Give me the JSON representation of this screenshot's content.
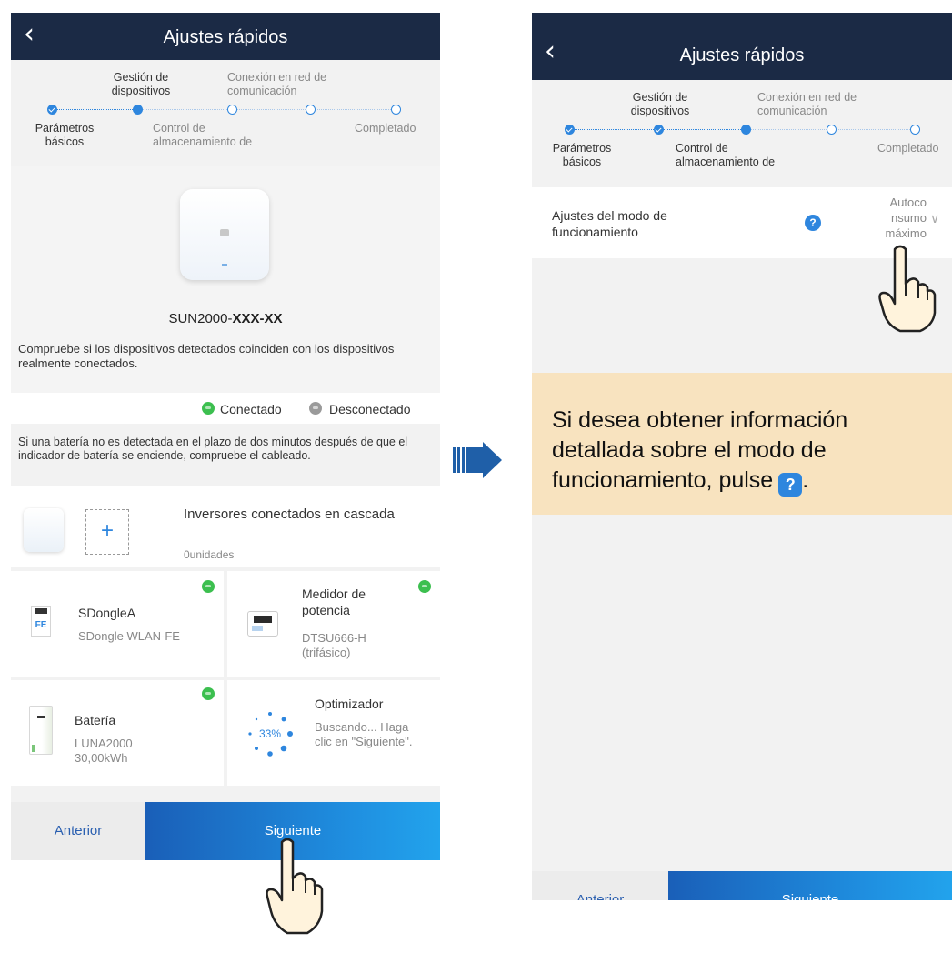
{
  "left": {
    "header": {
      "back_icon": "chevron-left-icon",
      "title": "Ajustes rápidos"
    },
    "steps": {
      "top_labels": [
        "Gestión de\ndispositivos",
        "Conexión en red de\ncomunicación"
      ],
      "bottom_labels": [
        "Parámetros\nbásicos",
        "Control de\nalmacenamiento de",
        "Completado"
      ]
    },
    "device": {
      "model_prefix": "SUN2000-",
      "model_bold": "XXX-XX"
    },
    "check_text": "Compruebe si los dispositivos detectados coinciden con los dispositivos realmente conectados.",
    "legend": {
      "connected": "Conectado",
      "disconnected": "Desconectado"
    },
    "battery_note": "Si una batería no es detectada en el plazo de dos minutos después de que el indicador de batería se enciende, compruebe el cableado.",
    "cascade": {
      "title": "Inversores conectados en cascada",
      "count": "0unidades",
      "add_icon": "plus-icon"
    },
    "cards": [
      {
        "name": "SDongleA",
        "detail": "SDongle WLAN-FE",
        "icon_text": "FE"
      },
      {
        "name": "Medidor de potencia",
        "detail": "DTSU666-H (trifásico)"
      },
      {
        "name": "Batería",
        "detail": "LUNA2000 30,00kWh"
      },
      {
        "name": "Optimizador",
        "detail": "Buscando... Haga clic en \"Siguiente\".",
        "progress": "33%"
      }
    ],
    "buttons": {
      "prev": "Anterior",
      "next": "Siguiente"
    }
  },
  "right": {
    "header": {
      "back_icon": "chevron-left-icon",
      "title": "Ajustes rápidos"
    },
    "steps": {
      "top_labels": [
        "Gestión de\ndispositivos",
        "Conexión en red de\ncomunicación"
      ],
      "bottom_labels": [
        "Parámetros\nbásicos",
        "Control de\nalmacenamiento de",
        "Completado"
      ]
    },
    "setting": {
      "label": "Ajustes del modo de funcionamiento",
      "help_icon": "question-icon",
      "value": "Autoco\nnsumo\nmáximo"
    },
    "note": {
      "text": "Si desea obtener información detallada sobre el modo de funcionamiento, pulse",
      "end": "."
    },
    "buttons": {
      "prev": "Anterior",
      "next": "Siguiente"
    }
  },
  "arrow_icon": "arrow-right-icon",
  "hand_icon": "pointing-hand-icon",
  "colors": {
    "header": "#1b2a45",
    "accent": "#2e86de",
    "note_bg": "#f8e3bf",
    "connected": "#3cbf4f"
  }
}
